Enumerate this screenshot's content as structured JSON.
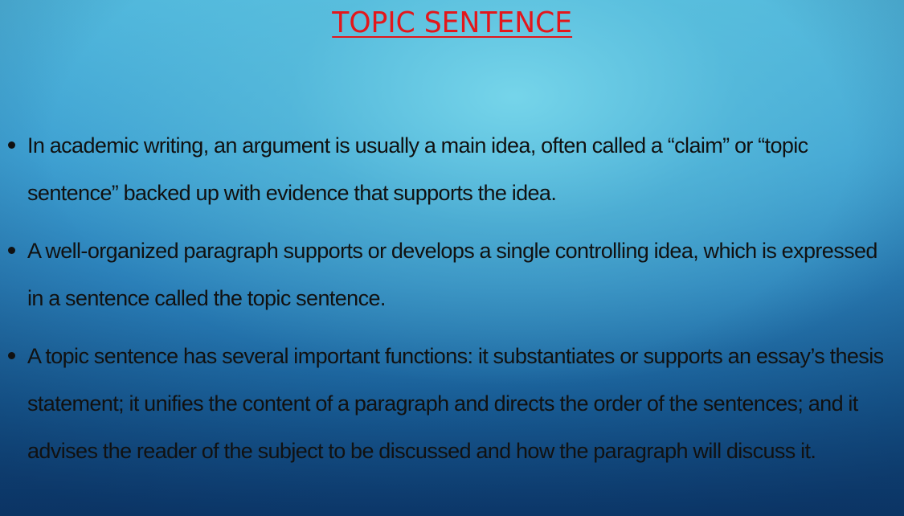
{
  "slide": {
    "title": "TOPIC SENTENCE",
    "title_color": "#e3171b",
    "bullets": [
      {
        "text": "In academic writing, an argument is usually a main idea, often called a “claim” or “topic sentence” backed up with evidence that supports the idea."
      },
      {
        "text": "A well-organized paragraph supports or develops a single controlling idea, which is expressed in a sentence called the topic sentence."
      },
      {
        "text": "A topic sentence has several important functions: it substantiates or supports an essay’s thesis statement; it unifies the content of a paragraph and directs the order of the sentences; and it advises the reader of the subject to be discussed and how the paragraph will discuss it."
      }
    ]
  }
}
